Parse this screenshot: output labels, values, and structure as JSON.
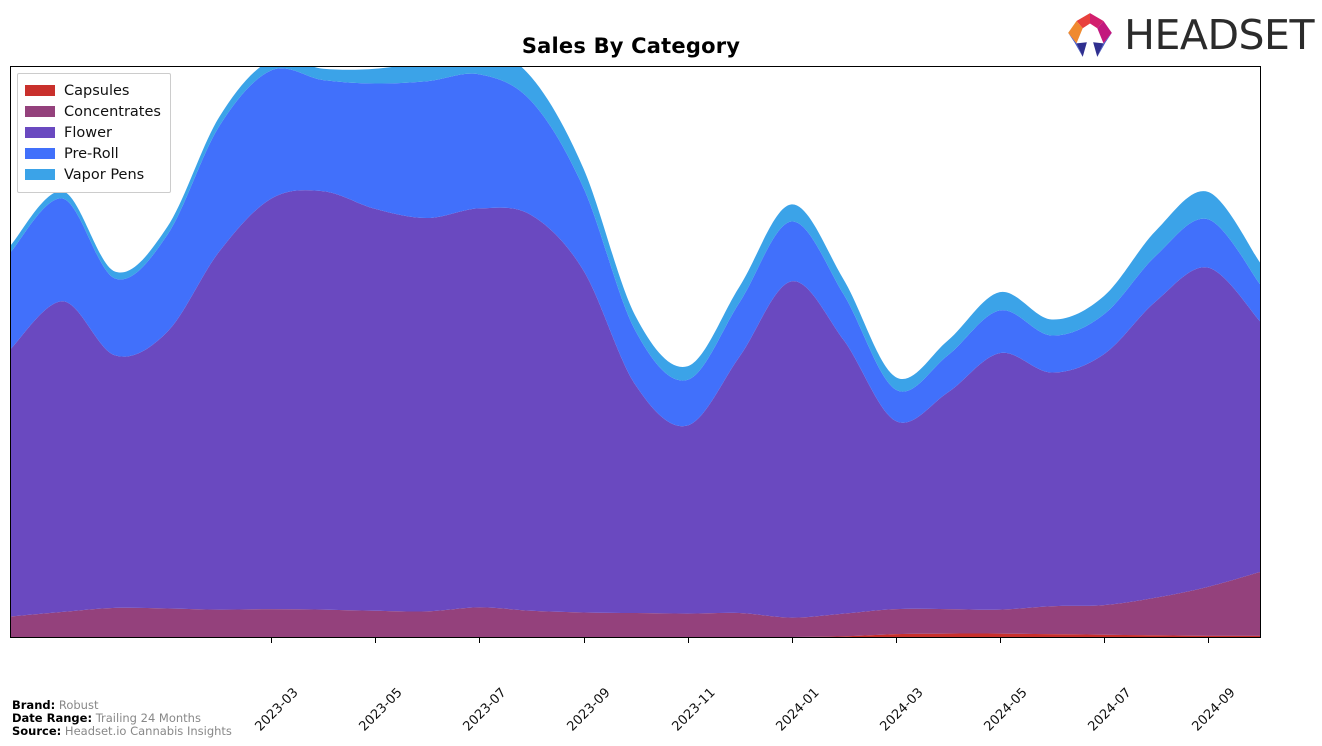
{
  "header": {
    "title": "Sales By Category",
    "logo_text": "HEADSET",
    "logo_icon": "headset-hexagon-logo"
  },
  "legend": {
    "position": "upper-left",
    "items": [
      {
        "label": "Capsules",
        "color": "#c9302c"
      },
      {
        "label": "Concentrates",
        "color": "#94417c"
      },
      {
        "label": "Flower",
        "color": "#6a49c0"
      },
      {
        "label": "Pre-Roll",
        "color": "#4170fb"
      },
      {
        "label": "Vapor Pens",
        "color": "#3ba3e8"
      }
    ]
  },
  "footer": {
    "rows": [
      {
        "key": "Brand:",
        "value": "Robust"
      },
      {
        "key": "Date Range:",
        "value": "Trailing 24 Months"
      },
      {
        "key": "Source:",
        "value": "Headset.io Cannabis Insights"
      }
    ]
  },
  "chart_data": {
    "type": "area",
    "stacked": true,
    "smoothing": "spline",
    "title": "Sales By Category",
    "xlabel": "",
    "ylabel": "",
    "grid": false,
    "legend_position": "upper-left",
    "x": [
      "2022-10",
      "2022-11",
      "2022-12",
      "2023-01",
      "2023-02",
      "2023-03",
      "2023-04",
      "2023-05",
      "2023-06",
      "2023-07",
      "2023-08",
      "2023-09",
      "2023-10",
      "2023-11",
      "2023-12",
      "2024-01",
      "2024-02",
      "2024-03",
      "2024-04",
      "2024-05",
      "2024-06",
      "2024-07",
      "2024-08",
      "2024-09",
      "2024-10"
    ],
    "tick_labels": [
      "2023-03",
      "2023-05",
      "2023-07",
      "2023-09",
      "2023-11",
      "2024-01",
      "2024-03",
      "2024-05",
      "2024-07",
      "2024-09"
    ],
    "ylim": [
      0,
      100
    ],
    "series": [
      {
        "name": "Capsules",
        "color": "#c9302c",
        "values": [
          0,
          0,
          0,
          0,
          0,
          0,
          0,
          0,
          0,
          0,
          0,
          0,
          0,
          0,
          0,
          0,
          0.1,
          0.5,
          0.6,
          0.6,
          0.5,
          0.4,
          0.3,
          0.2,
          0.2
        ]
      },
      {
        "name": "Concentrates",
        "color": "#94417c",
        "values": [
          3.6,
          4.4,
          5.1,
          5.0,
          4.8,
          4.9,
          4.8,
          4.6,
          4.5,
          5.2,
          4.6,
          4.3,
          4.2,
          4.1,
          4.2,
          3.4,
          4.0,
          4.4,
          4.3,
          4.2,
          4.9,
          5.2,
          6.6,
          8.6,
          11.2
        ]
      },
      {
        "name": "Flower",
        "color": "#6a49c0",
        "values": [
          47.0,
          54.5,
          44.3,
          48.5,
          62.8,
          72.0,
          73.4,
          70.5,
          69.0,
          70.0,
          69.4,
          60.0,
          40.0,
          33.0,
          45.0,
          59.0,
          48.0,
          33.0,
          38.0,
          45.0,
          41.0,
          44.0,
          52.0,
          56.0,
          44.0
        ]
      },
      {
        "name": "Pre-Roll",
        "color": "#4170fb",
        "values": [
          17.0,
          18.0,
          13.5,
          17.0,
          22.0,
          22.5,
          19.5,
          22.0,
          24.0,
          23.5,
          20.0,
          14.5,
          9.5,
          8.0,
          9.5,
          10.5,
          8.0,
          5.5,
          6.5,
          7.5,
          6.5,
          7.0,
          8.0,
          8.5,
          6.5
        ]
      },
      {
        "name": "Vapor Pens",
        "color": "#3ba3e8",
        "values": [
          1.2,
          1.3,
          1.2,
          1.4,
          1.6,
          1.8,
          2.0,
          2.6,
          3.6,
          5.0,
          4.2,
          3.4,
          2.6,
          2.4,
          2.8,
          3.0,
          2.6,
          2.2,
          2.6,
          3.2,
          2.8,
          3.2,
          4.4,
          4.8,
          3.8
        ]
      }
    ]
  }
}
